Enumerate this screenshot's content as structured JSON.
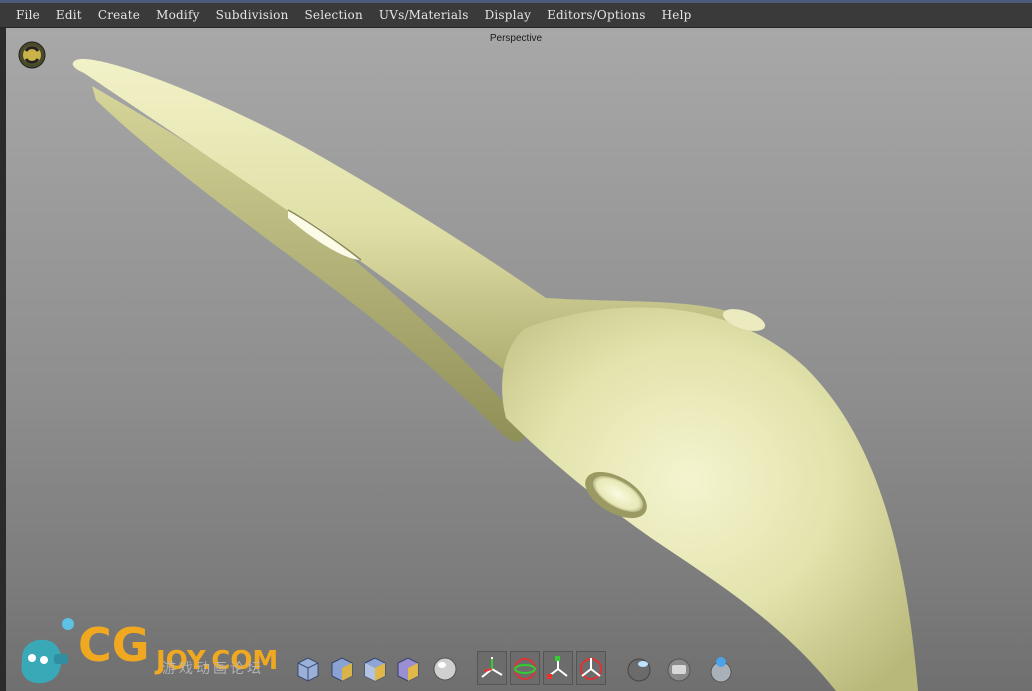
{
  "menu": {
    "items": [
      "File",
      "Edit",
      "Create",
      "Modify",
      "Subdivision",
      "Selection",
      "UVs/Materials",
      "Display",
      "Editors/Options",
      "Help"
    ]
  },
  "viewport": {
    "label": "Perspective"
  },
  "watermark": {
    "brand": "CG",
    "sub": "JOY.COM",
    "cn": "游戏动画论坛"
  },
  "shelf": {
    "tools": [
      "cube-flat-icon",
      "cube-shaded-icon",
      "cube-textured-icon",
      "cube-lit-icon",
      "sphere-icon",
      "move-tool-icon",
      "rotate-tool-icon",
      "scale-tool-icon",
      "universal-tool-icon",
      "sphere-light-icon",
      "material-icon",
      "render-icon"
    ]
  },
  "colors": {
    "menubar": "#3a3a3a",
    "model": "#e6e6b4",
    "viewport_top": "#a8a8a8",
    "viewport_bottom": "#6f6f6f"
  }
}
